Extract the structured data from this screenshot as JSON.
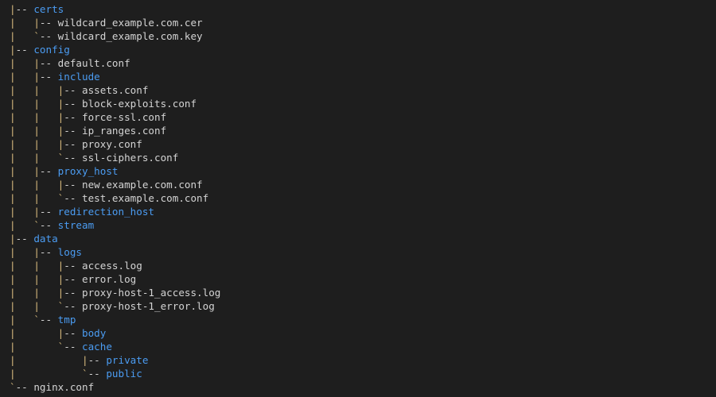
{
  "colors": {
    "background": "#1e1e1e",
    "tree_lines": "#d7ba7d",
    "directory": "#4b9cf2",
    "file": "#d4d4d4"
  },
  "tree": [
    {
      "guides": "|",
      "connector": "-- ",
      "name": "certs",
      "type": "dir"
    },
    {
      "guides": "|   |",
      "connector": "-- ",
      "name": "wildcard_example.com.cer",
      "type": "file"
    },
    {
      "guides": "|   `",
      "connector": "-- ",
      "name": "wildcard_example.com.key",
      "type": "file"
    },
    {
      "guides": "|",
      "connector": "-- ",
      "name": "config",
      "type": "dir"
    },
    {
      "guides": "|   |",
      "connector": "-- ",
      "name": "default.conf",
      "type": "file"
    },
    {
      "guides": "|   |",
      "connector": "-- ",
      "name": "include",
      "type": "dir"
    },
    {
      "guides": "|   |   |",
      "connector": "-- ",
      "name": "assets.conf",
      "type": "file"
    },
    {
      "guides": "|   |   |",
      "connector": "-- ",
      "name": "block-exploits.conf",
      "type": "file"
    },
    {
      "guides": "|   |   |",
      "connector": "-- ",
      "name": "force-ssl.conf",
      "type": "file"
    },
    {
      "guides": "|   |   |",
      "connector": "-- ",
      "name": "ip_ranges.conf",
      "type": "file"
    },
    {
      "guides": "|   |   |",
      "connector": "-- ",
      "name": "proxy.conf",
      "type": "file"
    },
    {
      "guides": "|   |   `",
      "connector": "-- ",
      "name": "ssl-ciphers.conf",
      "type": "file"
    },
    {
      "guides": "|   |",
      "connector": "-- ",
      "name": "proxy_host",
      "type": "dir"
    },
    {
      "guides": "|   |   |",
      "connector": "-- ",
      "name": "new.example.com.conf",
      "type": "file"
    },
    {
      "guides": "|   |   `",
      "connector": "-- ",
      "name": "test.example.com.conf",
      "type": "file"
    },
    {
      "guides": "|   |",
      "connector": "-- ",
      "name": "redirection_host",
      "type": "dir"
    },
    {
      "guides": "|   `",
      "connector": "-- ",
      "name": "stream",
      "type": "dir"
    },
    {
      "guides": "|",
      "connector": "-- ",
      "name": "data",
      "type": "dir"
    },
    {
      "guides": "|   |",
      "connector": "-- ",
      "name": "logs",
      "type": "dir"
    },
    {
      "guides": "|   |   |",
      "connector": "-- ",
      "name": "access.log",
      "type": "file"
    },
    {
      "guides": "|   |   |",
      "connector": "-- ",
      "name": "error.log",
      "type": "file"
    },
    {
      "guides": "|   |   |",
      "connector": "-- ",
      "name": "proxy-host-1_access.log",
      "type": "file"
    },
    {
      "guides": "|   |   `",
      "connector": "-- ",
      "name": "proxy-host-1_error.log",
      "type": "file"
    },
    {
      "guides": "|   `",
      "connector": "-- ",
      "name": "tmp",
      "type": "dir"
    },
    {
      "guides": "|       |",
      "connector": "-- ",
      "name": "body",
      "type": "dir"
    },
    {
      "guides": "|       `",
      "connector": "-- ",
      "name": "cache",
      "type": "dir"
    },
    {
      "guides": "|           |",
      "connector": "-- ",
      "name": "private",
      "type": "dir"
    },
    {
      "guides": "|           `",
      "connector": "-- ",
      "name": "public",
      "type": "dir"
    },
    {
      "guides": "`",
      "connector": "-- ",
      "name": "nginx.conf",
      "type": "file"
    }
  ]
}
